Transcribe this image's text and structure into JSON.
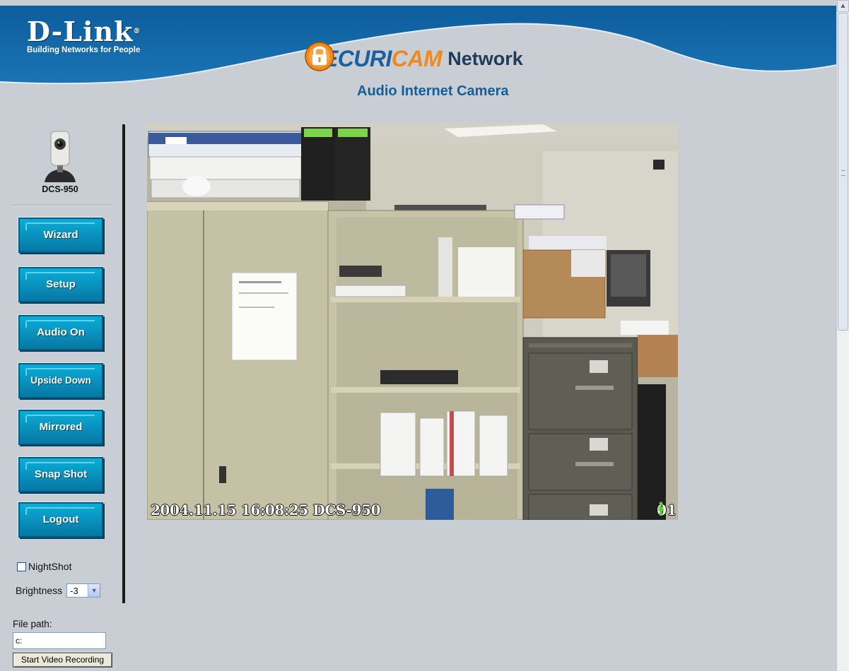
{
  "header": {
    "brand_name": "D-Link",
    "brand_reg": "®",
    "brand_tagline": "Building Networks for People",
    "product_part1": "SECURI",
    "product_part2": "CAM",
    "product_part3": "Network",
    "subtitle": "Audio Internet Camera"
  },
  "sidebar": {
    "model_name": "DCS-950",
    "buttons": [
      {
        "label": "Wizard"
      },
      {
        "label": "Setup"
      },
      {
        "label": "Audio On"
      },
      {
        "label": "Upside Down"
      },
      {
        "label": "Mirrored"
      },
      {
        "label": "Snap Shot"
      },
      {
        "label": "Logout"
      }
    ],
    "nightshot_label": "NightShot",
    "nightshot_checked": false,
    "brightness_label": "Brightness",
    "brightness_value": "-3",
    "file_path_label": "File path:",
    "file_path_value": "c:",
    "record_button": "Start Video Recording"
  },
  "video": {
    "timestamp_overlay": "2004.11.15 16:08:25 DCS-950",
    "camera_number": "01"
  },
  "colors": {
    "header_blue": "#1667a6",
    "button_blue": "#0a93c0",
    "background": "#c9ced4",
    "accent_orange": "#f08a1c"
  },
  "icons": [
    "lock-icon",
    "camera-icon",
    "person-icon",
    "scroll-up-arrow-icon",
    "chevron-down-icon"
  ]
}
